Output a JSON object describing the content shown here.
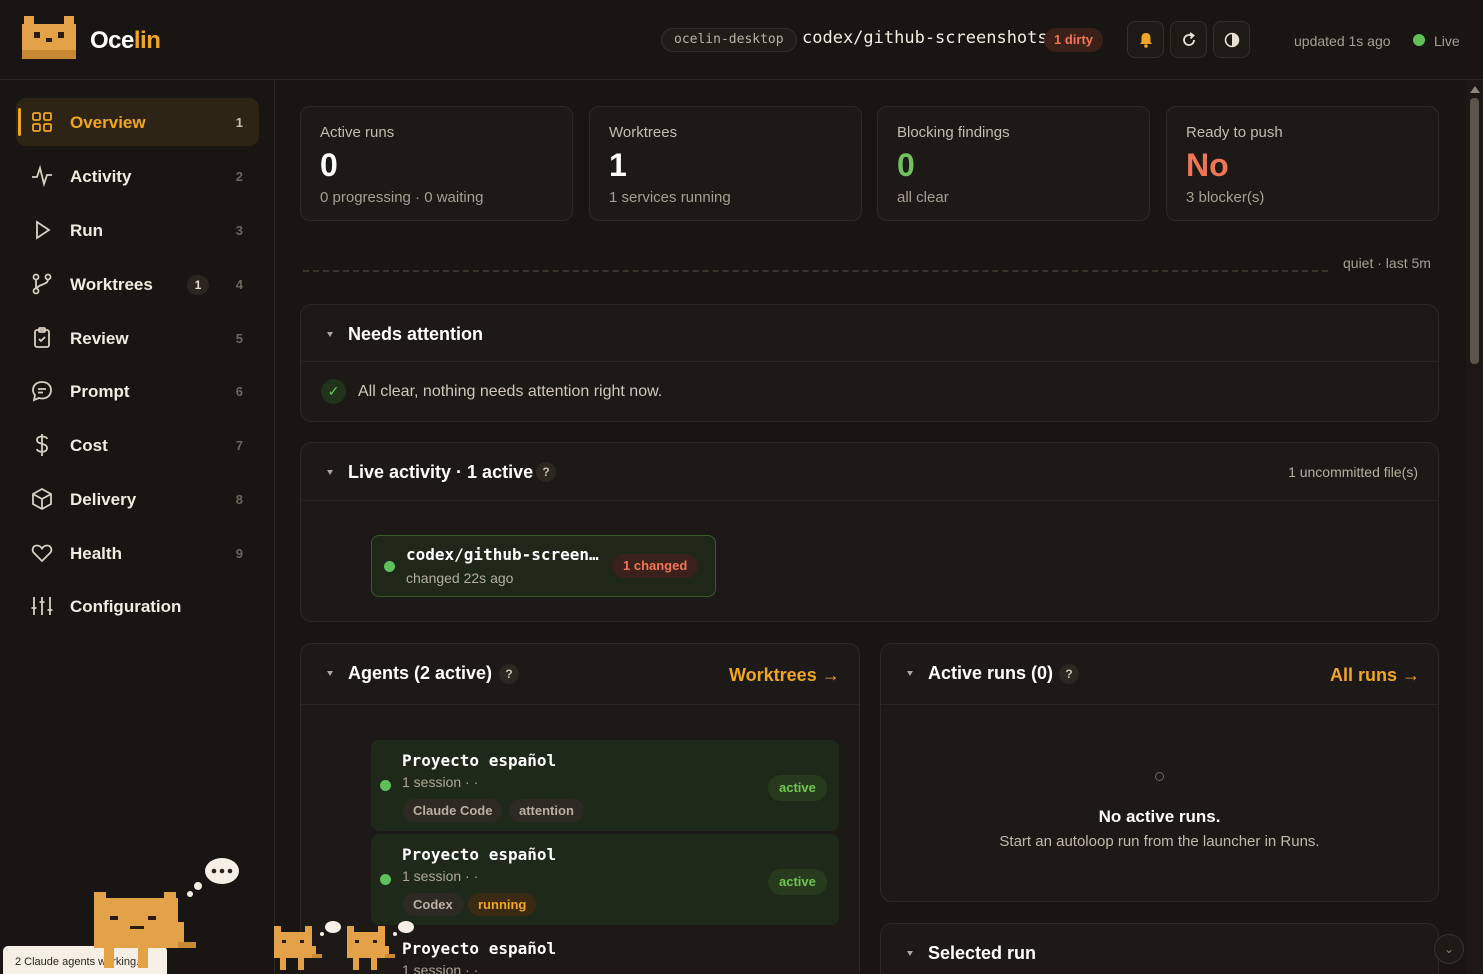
{
  "header": {
    "brand_prefix": "Oce",
    "brand_suffix": "lin",
    "host": "ocelin-desktop",
    "branch": "codex/github-screenshots",
    "dirty": "1 dirty",
    "updated": "updated 1s ago",
    "live": "Live",
    "icons": [
      "bell-icon",
      "refresh-icon",
      "theme-icon"
    ]
  },
  "sidebar": {
    "items": [
      {
        "label": "Overview",
        "num": "1",
        "icon": "grid-icon"
      },
      {
        "label": "Activity",
        "num": "2",
        "icon": "pulse-icon"
      },
      {
        "label": "Run",
        "num": "3",
        "icon": "play-icon"
      },
      {
        "label": "Worktrees",
        "num": "4",
        "badge": "1",
        "icon": "branch-icon"
      },
      {
        "label": "Review",
        "num": "5",
        "icon": "clipboard-check-icon"
      },
      {
        "label": "Prompt",
        "num": "6",
        "icon": "chat-icon"
      },
      {
        "label": "Cost",
        "num": "7",
        "icon": "dollar-icon"
      },
      {
        "label": "Delivery",
        "num": "8",
        "icon": "box-icon"
      },
      {
        "label": "Health",
        "num": "9",
        "icon": "heart-icon"
      },
      {
        "label": "Configuration",
        "num": "",
        "icon": "sliders-icon"
      }
    ],
    "toast": "2 Claude agents working."
  },
  "stats": [
    {
      "label": "Active runs",
      "value": "0",
      "sub": "0 progressing · 0 waiting"
    },
    {
      "label": "Worktrees",
      "value": "1",
      "sub": "1 services running"
    },
    {
      "label": "Blocking findings",
      "value": "0",
      "sub": "all clear"
    },
    {
      "label": "Ready to push",
      "value": "No",
      "sub": "3 blocker(s)"
    }
  ],
  "activity_strip": {
    "label": "quiet · last 5m"
  },
  "needs_attention": {
    "title": "Needs attention",
    "message": "All clear, nothing needs attention right now."
  },
  "live_activity": {
    "title": "Live activity · 1 active",
    "right": "1 uncommitted file(s)",
    "card": {
      "name": "codex/github-screen…",
      "sub": "changed 22s ago",
      "badge": "1 changed"
    }
  },
  "agents": {
    "title": "Agents (2 active)",
    "link": "Worktrees →",
    "items": [
      {
        "name": "Proyecto español",
        "sub": "1 session · ·",
        "chips": [
          "Claude Code",
          "attention"
        ],
        "status": "active"
      },
      {
        "name": "Proyecto español",
        "sub": "1 session · ·",
        "chips": [
          "Codex",
          "running"
        ],
        "status": "active"
      },
      {
        "name": "Proyecto español",
        "sub": "1 session · ·"
      }
    ]
  },
  "active_runs": {
    "title": "Active runs (0)",
    "link": "All runs →",
    "empty_title": "No active runs.",
    "empty_sub": "Start an autoloop run from the launcher in Runs."
  },
  "selected_run": {
    "title": "Selected run"
  },
  "colors": {
    "accent": "#f0a623",
    "success": "#5fbf5a",
    "danger": "#f07553",
    "background": "#181512"
  }
}
